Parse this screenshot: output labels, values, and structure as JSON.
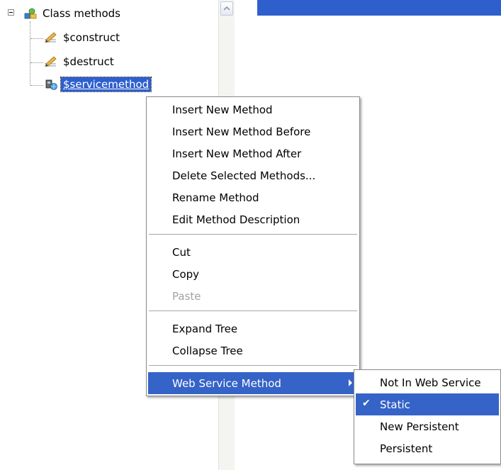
{
  "tree": {
    "root_label": "Class methods",
    "children": [
      {
        "label": "$construct",
        "icon": "method-pencil-icon"
      },
      {
        "label": "$destruct",
        "icon": "method-pencil-icon"
      },
      {
        "label": "$servicemethod",
        "icon": "web-service-method-icon",
        "selected": true
      }
    ]
  },
  "context_menu": {
    "groups": [
      [
        {
          "label": "Insert New Method",
          "access_key": "I"
        },
        {
          "label": "Insert New Method Before",
          "access_key": "B"
        },
        {
          "label": "Insert New Method After",
          "access_key": "A"
        },
        {
          "label": "Delete Selected Methods...",
          "access_key": "D"
        },
        {
          "label": "Rename Method",
          "access_key": "R"
        },
        {
          "label": "Edit Method Description",
          "access_key": "M"
        }
      ],
      [
        {
          "label": "Cut",
          "access_key": "t"
        },
        {
          "label": "Copy",
          "access_key": "C"
        },
        {
          "label": "Paste",
          "access_key": "P",
          "disabled": true
        }
      ],
      [
        {
          "label": "Expand Tree",
          "access_key": "E"
        },
        {
          "label": "Collapse Tree",
          "access_key": "o"
        }
      ],
      [
        {
          "label": "Web Service Method",
          "access_key": "W",
          "submenu": true,
          "highlighted": true
        }
      ]
    ]
  },
  "submenu": {
    "items": [
      {
        "label": "Not In Web Service",
        "access_key": "t"
      },
      {
        "label": "Static",
        "access_key": "S",
        "checked": true,
        "highlighted": true
      },
      {
        "label": "New Persistent",
        "access_key": "N"
      },
      {
        "label": "Persistent",
        "access_key": "P"
      }
    ]
  },
  "colors": {
    "selection": "#3563c7",
    "top_bar": "#2f5fcc",
    "disabled_text": "#a3a3a3"
  }
}
